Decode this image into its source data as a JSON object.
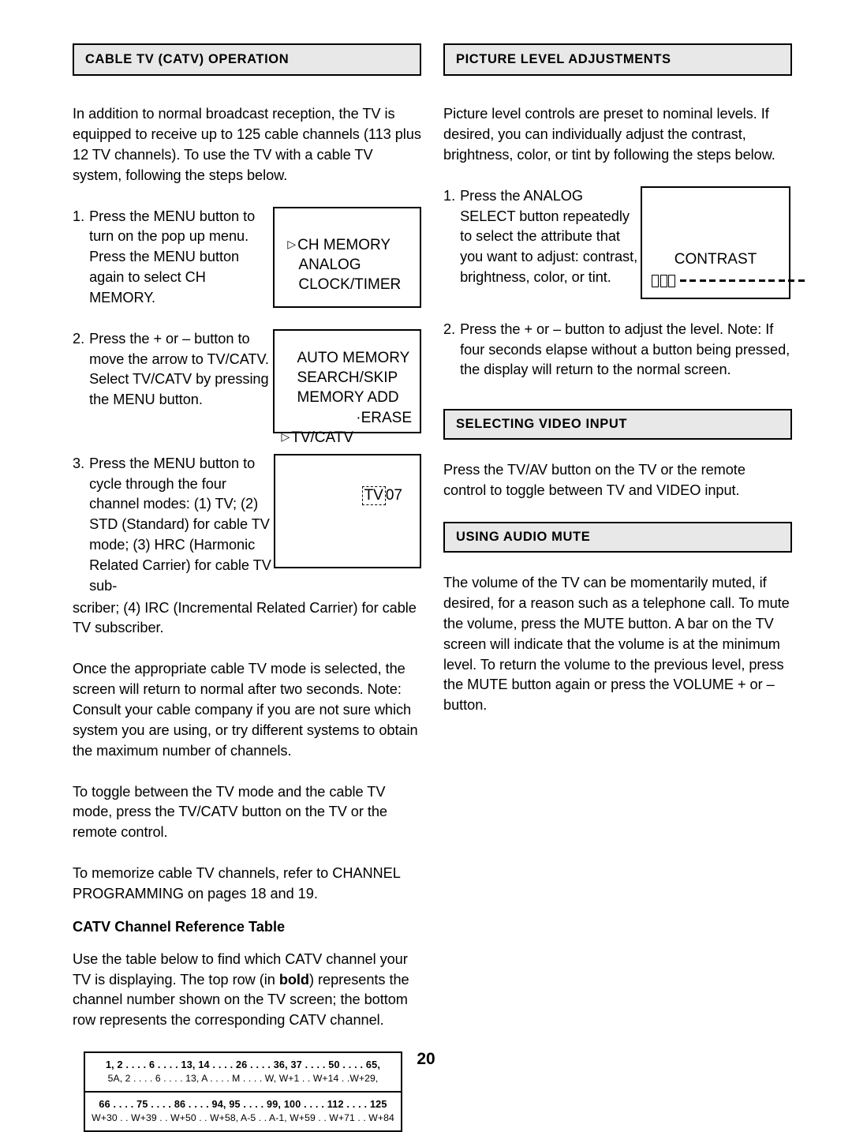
{
  "page": {
    "number": "20"
  },
  "left_column": {
    "section_title": "CABLE TV (CATV) OPERATION",
    "intro": "In addition to normal broadcast reception, the TV is equipped to receive up to 125 cable channels (113 plus 12 TV channels). To use the TV with a cable TV system, following the steps below.",
    "steps": [
      {
        "number": "1.",
        "text": "Press the MENU button to turn on the pop up menu. Press the MENU button again to select CH MEMORY."
      },
      {
        "number": "2.",
        "text": "Press the + or – button to move the arrow to TV/CATV. Select TV/CATV by pressing the MENU button."
      },
      {
        "number": "3.",
        "text": "Press the MENU button to cycle through the four channel modes: (1) TV; (2) STD (Standard) for cable TV mode; (3) HRC (Harmonic Related Carrier) for cable TV sub-"
      }
    ],
    "step3_continuation": "scriber; (4) IRC (Incremental Related Carrier) for cable TV subscriber.",
    "osd_menu_1": {
      "arrow": "▷",
      "items": [
        "CH MEMORY",
        "ANALOG",
        "CLOCK/TIMER"
      ]
    },
    "osd_menu_2": {
      "arrow": "▷",
      "items": [
        "AUTO MEMORY",
        "SEARCH/SKIP",
        "MEMORY ADD"
      ],
      "erase_item": "·ERASE",
      "selected_item": "TV/CATV"
    },
    "osd_tv_display": {
      "mode_badge": "TV",
      "channel": "07"
    },
    "paragraphs": [
      "Once the appropriate cable TV mode is selected, the screen will return to normal after two seconds. Note: Consult your cable company if you are not sure which system you are using, or try different systems to obtain the maximum number of channels.",
      "To toggle between the TV mode and the cable TV mode, press the TV/CATV button on the TV or the remote control.",
      "To memorize cable TV channels, refer to CHANNEL PROGRAMMING on pages 18 and 19."
    ],
    "table_heading": "CATV Channel Reference Table",
    "table_intro_a": "Use the table below to find which CATV channel your TV  is displaying. The top row (in ",
    "table_intro_bold": "bold",
    "table_intro_b": ") represents the channel number shown on the TV screen; the bottom row represents the corresponding CATV channel.",
    "channel_table": {
      "rows": [
        {
          "tv": "1, 2 . . . . 6 . . . . 13, 14 . . . . 26 . . . . 36, 37 . . . . 50 . . . . 65,",
          "catv": "5A, 2 . . . . 6 . . . . 13, A . . . .  M . . . . W, W+1 . . W+14 . .W+29,"
        },
        {
          "tv": "66 . . . . 75 . . . . 86 . . . . 94, 95 . . . . 99, 100 . . . . 112 . . . . 125",
          "catv": "W+30 . . W+39 . . W+50 . . W+58, A-5 . . A-1, W+59 . . W+71 . . W+84"
        }
      ]
    }
  },
  "right_column": {
    "sections": [
      {
        "title": "PICTURE LEVEL ADJUSTMENTS",
        "intro": "Picture level controls are preset to nominal levels. If desired, you can individually adjust the contrast, brightness, color, or tint by following the steps below.",
        "steps": [
          {
            "number": "1.",
            "text": "Press the ANALOG SELECT button repeatedly to select the attribute that you want to adjust: contrast, brightness, color, or tint."
          },
          {
            "number": "2.",
            "text": "Press the + or – button to adjust the level. Note: If four seconds elapse without a button being pressed, the display will return to the normal screen."
          }
        ],
        "osd_contrast": {
          "label": "CONTRAST",
          "filled_blocks": 3,
          "dashes": 13
        }
      },
      {
        "title": "SELECTING VIDEO INPUT",
        "body": "Press the TV/AV button on the TV or the remote control to toggle between TV and VIDEO input."
      },
      {
        "title": "USING AUDIO MUTE",
        "body": "The volume of the TV can be momentarily muted, if desired, for a reason such as a telephone call. To mute the volume, press the MUTE button. A bar on the TV screen will indicate that the volume is at the minimum level. To return the volume to the previous level, press the MUTE button again or press the VOLUME + or – button."
      }
    ]
  }
}
